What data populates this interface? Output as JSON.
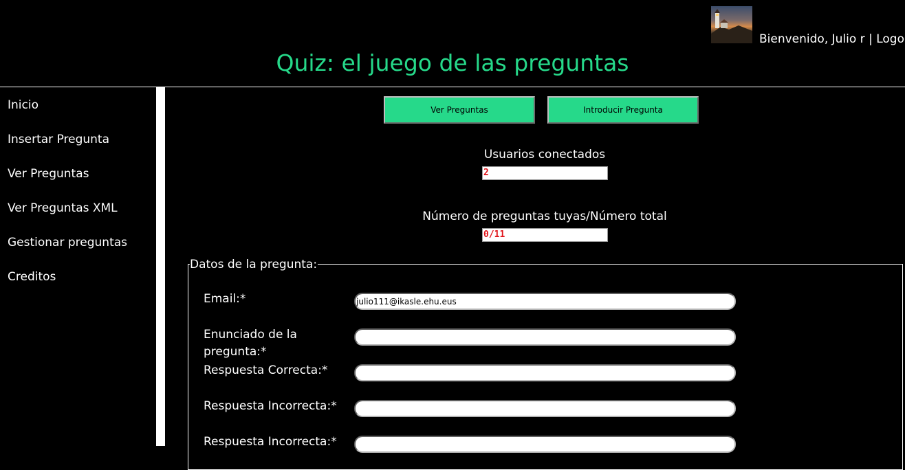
{
  "header": {
    "welcome_text": "Bienvenido, Julio r | ",
    "logout_label": "Logout",
    "site_title": "Quiz: el juego de las preguntas"
  },
  "sidebar": {
    "items": [
      {
        "label": "Inicio"
      },
      {
        "label": "Insertar Pregunta"
      },
      {
        "label": "Ver Preguntas"
      },
      {
        "label": "Ver Preguntas XML"
      },
      {
        "label": "Gestionar preguntas"
      },
      {
        "label": "Creditos"
      }
    ]
  },
  "main": {
    "buttons": {
      "ver_preguntas": "Ver Preguntas",
      "introducir_pregunta": "Introducir Pregunta"
    },
    "usuarios_conectados": {
      "label": "Usuarios conectados",
      "value": "2"
    },
    "preguntas_stats": {
      "label": "Número de preguntas tuyas/Número total",
      "value": "0/11"
    }
  },
  "form": {
    "legend": "Datos de la pregunta:",
    "fields": [
      {
        "label": "Email:*",
        "value": "julio111@ikasle.ehu.eus"
      },
      {
        "label": "Enunciado de la pregunta:*",
        "value": ""
      },
      {
        "label": "Respuesta Correcta:*",
        "value": ""
      },
      {
        "label": "Respuesta Incorrecta:*",
        "value": ""
      },
      {
        "label": "Respuesta Incorrecta:*",
        "value": ""
      }
    ]
  },
  "colors": {
    "accent": "#26d98a",
    "background": "#000000",
    "stat_value": "#e0141a"
  }
}
